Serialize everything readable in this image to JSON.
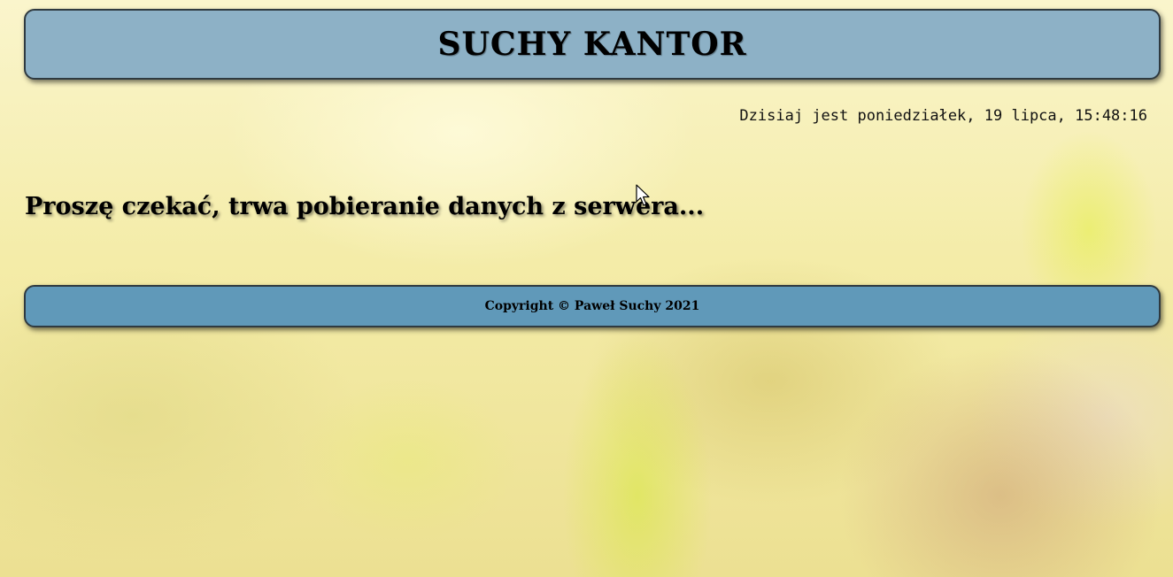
{
  "header": {
    "title": "SUCHY KANTOR"
  },
  "date_line": "Dzisiaj jest poniedziałek, 19 lipca, 15:48:16",
  "main": {
    "loading_message": "Proszę czekać, trwa pobieranie danych z serwera..."
  },
  "footer": {
    "copyright": "Copyright © Paweł Suchy 2021"
  },
  "colors": {
    "header_bg": "#8db1c6",
    "footer_bg": "#6099b9"
  },
  "cursor_icon": "arrow-pointer"
}
